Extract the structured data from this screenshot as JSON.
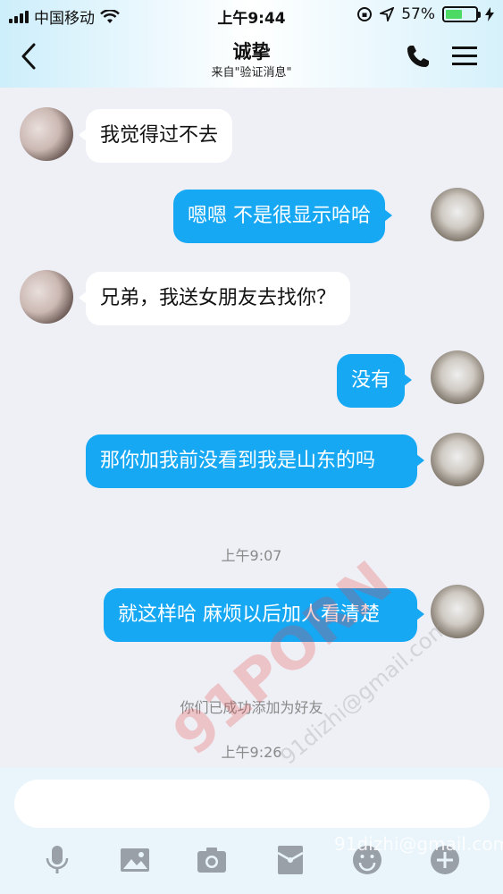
{
  "status_bar": {
    "carrier": "中国移动",
    "time": "上午9:44",
    "battery_percent": "57%",
    "battery_level": 0.57
  },
  "header": {
    "title": "诚挚",
    "subtitle": "来自\"验证消息\""
  },
  "messages": [
    {
      "from": "them",
      "text": "我觉得过不去"
    },
    {
      "from": "me",
      "text": "嗯嗯 不是很显示哈哈"
    },
    {
      "from": "them",
      "text": "兄弟，我送女朋友去找你？"
    },
    {
      "from": "me",
      "text": "没有"
    },
    {
      "from": "me",
      "text": "那你加我前没看到我是山东的吗"
    },
    {
      "from": "me",
      "text": "就这样哈 麻烦以后加人看清楚"
    }
  ],
  "timestamps": [
    "上午9:07",
    "上午9:26"
  ],
  "system_message": "你们已成功添加为好友",
  "input": {
    "placeholder": ""
  },
  "toolbar": [
    "mic-icon",
    "image-icon",
    "camera-icon",
    "red-envelope-icon",
    "emoji-icon",
    "plus-icon"
  ],
  "watermarks": [
    "91PORN",
    "91dizhi@gmail.com",
    "91dizhi@gmail.com"
  ],
  "colors": {
    "bubble_me": "#17a8f4",
    "bubble_them": "#ffffff",
    "background": "#eef0f6"
  }
}
